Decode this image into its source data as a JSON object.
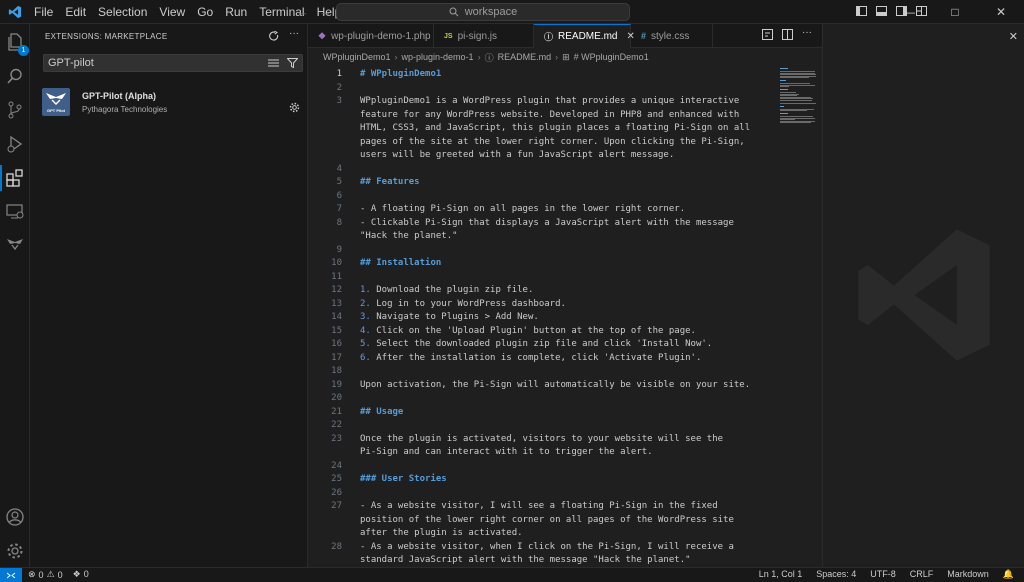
{
  "menu": [
    "File",
    "Edit",
    "Selection",
    "View",
    "Go",
    "Run",
    "Terminal",
    "Help"
  ],
  "command_center": {
    "label": "workspace"
  },
  "activity_bar": {
    "extensions_badge": "1"
  },
  "sidebar": {
    "title": "EXTENSIONS: MARKETPLACE",
    "search_value": "GPT-pilot",
    "extension": {
      "name": "GPT-Pilot (Alpha)",
      "publisher": "Pythagora Technologies",
      "logo_text": "GPT Pilot"
    }
  },
  "tabs": [
    {
      "label": "wp-plugin-demo-1.php",
      "icon": "php-icon",
      "active": false
    },
    {
      "label": "pi-sign.js",
      "icon": "js-icon",
      "active": false
    },
    {
      "label": "README.md",
      "icon": "info-icon",
      "active": true
    },
    {
      "label": "style.css",
      "icon": "css-icon",
      "active": false
    }
  ],
  "breadcrumb": [
    "WPpluginDemo1",
    "wp-plugin-demo-1",
    "README.md",
    "# WPpluginDemo1"
  ],
  "code_lines": [
    {
      "n": "1",
      "t": "# WPpluginDemo1",
      "k": "h"
    },
    {
      "n": "2",
      "t": "",
      "k": "p"
    },
    {
      "n": "3",
      "t": "WPpluginDemo1 is a WordPress plugin that provides a unique interactive",
      "k": "p"
    },
    {
      "n": "",
      "t": "feature for any WordPress website. Developed in PHP8 and enhanced with",
      "k": "p"
    },
    {
      "n": "",
      "t": "HTML, CSS3, and JavaScript, this plugin places a floating Pi-Sign on all",
      "k": "p"
    },
    {
      "n": "",
      "t": "pages of the site at the lower right corner. Upon clicking the Pi-Sign,",
      "k": "p"
    },
    {
      "n": "",
      "t": "users will be greeted with a fun JavaScript alert message.",
      "k": "p"
    },
    {
      "n": "4",
      "t": "",
      "k": "p"
    },
    {
      "n": "5",
      "t": "## Features",
      "k": "h"
    },
    {
      "n": "6",
      "t": "",
      "k": "p"
    },
    {
      "n": "7",
      "t": "- A floating Pi-Sign on all pages in the lower right corner.",
      "k": "p"
    },
    {
      "n": "8",
      "t": "- Clickable Pi-Sign that displays a JavaScript alert with the message",
      "k": "p"
    },
    {
      "n": "",
      "t": "\"Hack the planet.\"",
      "k": "p"
    },
    {
      "n": "9",
      "t": "",
      "k": "p"
    },
    {
      "n": "10",
      "t": "## Installation",
      "k": "h"
    },
    {
      "n": "11",
      "t": "",
      "k": "p"
    },
    {
      "n": "12",
      "t": "1. Download the plugin zip file.",
      "k": "o"
    },
    {
      "n": "13",
      "t": "2. Log in to your WordPress dashboard.",
      "k": "o"
    },
    {
      "n": "14",
      "t": "3. Navigate to Plugins > Add New.",
      "k": "o"
    },
    {
      "n": "15",
      "t": "4. Click on the 'Upload Plugin' button at the top of the page.",
      "k": "o"
    },
    {
      "n": "16",
      "t": "5. Select the downloaded plugin zip file and click 'Install Now'.",
      "k": "o"
    },
    {
      "n": "17",
      "t": "6. After the installation is complete, click 'Activate Plugin'.",
      "k": "o"
    },
    {
      "n": "18",
      "t": "",
      "k": "p"
    },
    {
      "n": "19",
      "t": "Upon activation, the Pi-Sign will automatically be visible on your site.",
      "k": "p"
    },
    {
      "n": "20",
      "t": "",
      "k": "p"
    },
    {
      "n": "21",
      "t": "## Usage",
      "k": "h"
    },
    {
      "n": "22",
      "t": "",
      "k": "p"
    },
    {
      "n": "23",
      "t": "Once the plugin is activated, visitors to your website will see the",
      "k": "p"
    },
    {
      "n": "",
      "t": "Pi-Sign and can interact with it to trigger the alert.",
      "k": "p"
    },
    {
      "n": "24",
      "t": "",
      "k": "p"
    },
    {
      "n": "25",
      "t": "### User Stories",
      "k": "h"
    },
    {
      "n": "26",
      "t": "",
      "k": "p"
    },
    {
      "n": "27",
      "t": "- As a website visitor, I will see a floating Pi-Sign in the fixed",
      "k": "p"
    },
    {
      "n": "",
      "t": "position of the lower right corner on all pages of the WordPress site",
      "k": "p"
    },
    {
      "n": "",
      "t": "after the plugin is activated.",
      "k": "p"
    },
    {
      "n": "28",
      "t": "- As a website visitor, when I click on the Pi-Sign, I will receive a",
      "k": "p"
    },
    {
      "n": "",
      "t": "standard JavaScript alert with the message \"Hack the planet.\"",
      "k": "p"
    }
  ],
  "status_bar": {
    "errors": "0",
    "warnings": "0",
    "ports": "0",
    "position": "Ln 1, Col 1",
    "spaces": "Spaces: 4",
    "encoding": "UTF-8",
    "eol": "CRLF",
    "language": "Markdown"
  },
  "colors": {
    "accent": "#0078d4",
    "heading": "#569cd6",
    "list_number": "#6796e6",
    "php": "#a074c4",
    "js": "#cbcb41",
    "css": "#519aba"
  }
}
